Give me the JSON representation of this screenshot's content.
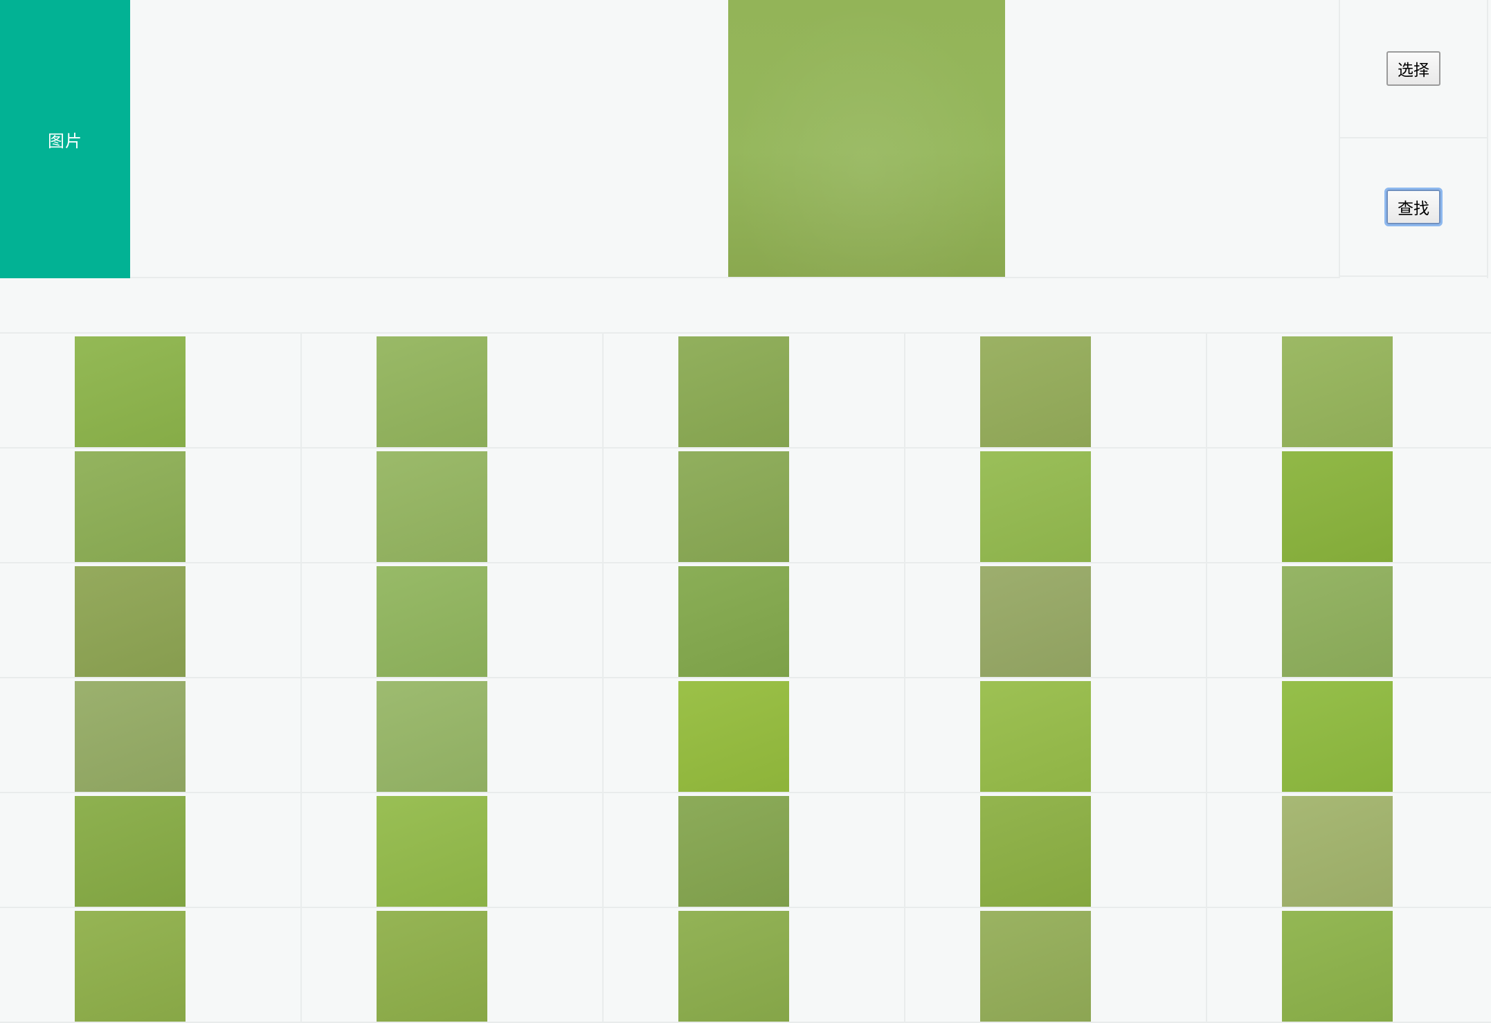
{
  "form": {
    "label": "图片",
    "select_button": "选择",
    "search_button": "查找"
  },
  "preview": {
    "icon": "image-preview",
    "color": "#93b458"
  },
  "results": {
    "columns": 5,
    "rows": [
      [
        "#8db54b",
        "#93b55d",
        "#8bab53",
        "#95ad5a",
        "#96b55b"
      ],
      [
        "#8daf55",
        "#95b661",
        "#8aaa54",
        "#94bb4f",
        "#8ab43c"
      ],
      [
        "#8ea553",
        "#91b65e",
        "#83a94c",
        "#97a965",
        "#8fb05c"
      ],
      [
        "#95ac65",
        "#97b767",
        "#95bd3d",
        "#97bd49",
        "#8fbb3f"
      ],
      [
        "#87ac45",
        "#93bb4a",
        "#85a64f",
        "#8cb043",
        "#a2b46c"
      ],
      [
        "#8fb04a",
        "#8fb04a",
        "#8cae4c",
        "#94ae58",
        "#8db34a"
      ]
    ]
  }
}
